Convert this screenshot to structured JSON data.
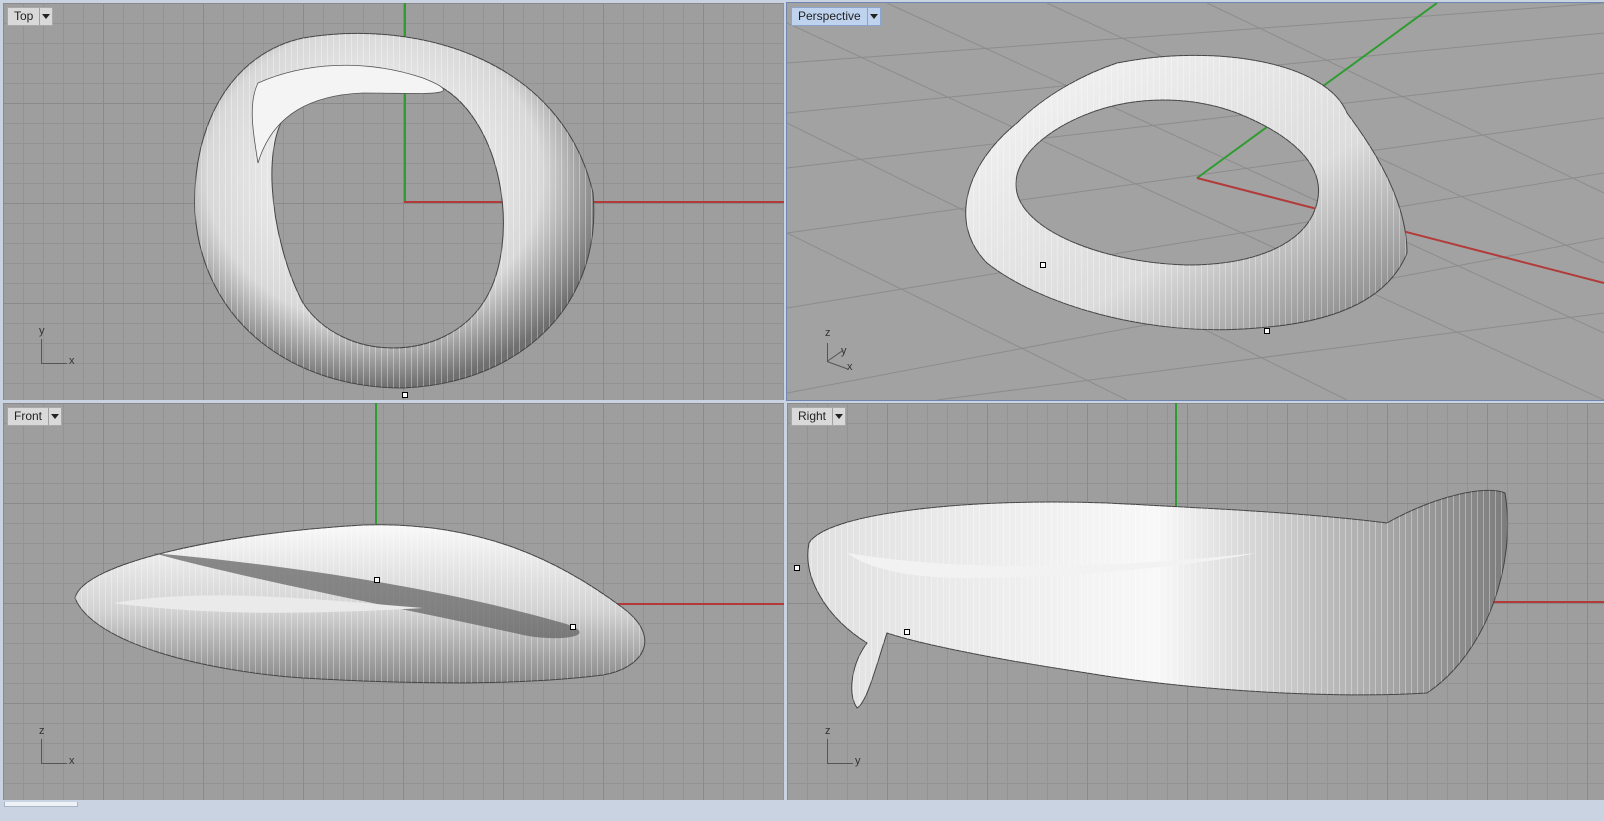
{
  "viewports": {
    "top": {
      "title": "Top",
      "triad_a": "y",
      "triad_b": "x"
    },
    "perspective": {
      "title": "Perspective",
      "triad_a": "z",
      "triad_mid": "y",
      "triad_b": "x"
    },
    "front": {
      "title": "Front",
      "triad_a": "z",
      "triad_b": "x"
    },
    "right": {
      "title": "Right",
      "triad_a": "z",
      "triad_b": "y"
    }
  },
  "colors": {
    "x_axis": "#b33a3a",
    "y_axis": "#2f9c2f",
    "active_tab": "#bfd2ee",
    "grid_background": "#9e9e9e"
  }
}
